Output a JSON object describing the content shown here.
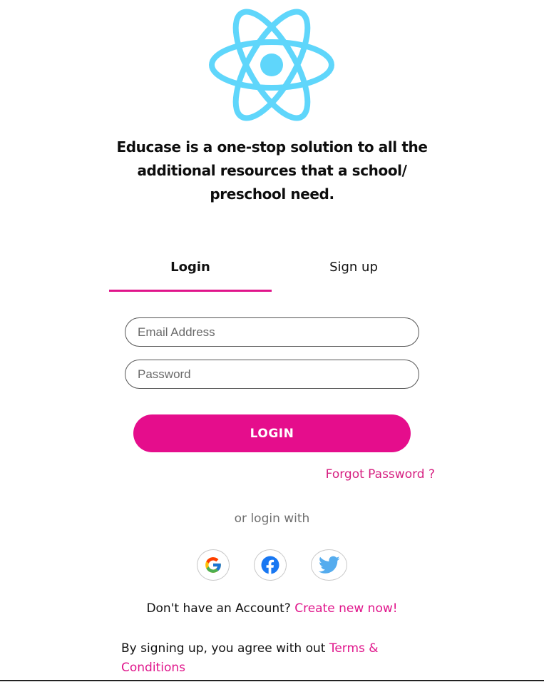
{
  "brand": {
    "logo_icon": "react-atom-icon",
    "logo_color": "#61DAFB",
    "tagline": "Educase is a one-stop solution to all the additional resources that a school/ preschool need."
  },
  "tabs": [
    {
      "label": "Login",
      "active": true
    },
    {
      "label": "Sign up",
      "active": false
    }
  ],
  "form": {
    "email_placeholder": "Email Address",
    "password_placeholder": "Password",
    "email_value": "",
    "password_value": "",
    "login_label": "LOGIN",
    "forgot_label": "Forgot Password ?"
  },
  "social": {
    "caption": "or login with",
    "providers": [
      {
        "name": "Google",
        "icon": "google-icon"
      },
      {
        "name": "Facebook",
        "icon": "facebook-icon"
      },
      {
        "name": "Twitter",
        "icon": "twitter-icon"
      }
    ]
  },
  "signup_prompt": {
    "text": "Don't have an Account?",
    "link": "Create new now!"
  },
  "terms": {
    "text": "By signing up, you agree with out",
    "link": "Terms & Conditions"
  },
  "colors": {
    "accent": "#E50D8C",
    "link": "#E0158B",
    "muted_text": "#6F6F6F"
  }
}
